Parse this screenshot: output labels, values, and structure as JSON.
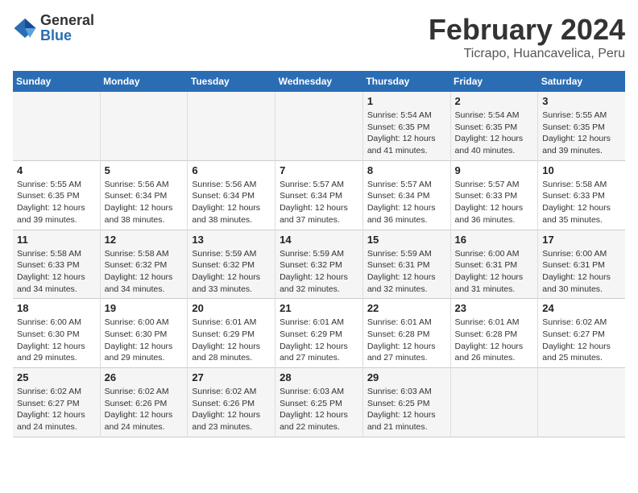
{
  "header": {
    "logo_general": "General",
    "logo_blue": "Blue",
    "title": "February 2024",
    "subtitle": "Ticrapo, Huancavelica, Peru"
  },
  "weekdays": [
    "Sunday",
    "Monday",
    "Tuesday",
    "Wednesday",
    "Thursday",
    "Friday",
    "Saturday"
  ],
  "weeks": [
    {
      "days": [
        {
          "num": "",
          "info": ""
        },
        {
          "num": "",
          "info": ""
        },
        {
          "num": "",
          "info": ""
        },
        {
          "num": "",
          "info": ""
        },
        {
          "num": "1",
          "info": "Sunrise: 5:54 AM\nSunset: 6:35 PM\nDaylight: 12 hours\nand 41 minutes."
        },
        {
          "num": "2",
          "info": "Sunrise: 5:54 AM\nSunset: 6:35 PM\nDaylight: 12 hours\nand 40 minutes."
        },
        {
          "num": "3",
          "info": "Sunrise: 5:55 AM\nSunset: 6:35 PM\nDaylight: 12 hours\nand 39 minutes."
        }
      ]
    },
    {
      "days": [
        {
          "num": "4",
          "info": "Sunrise: 5:55 AM\nSunset: 6:35 PM\nDaylight: 12 hours\nand 39 minutes."
        },
        {
          "num": "5",
          "info": "Sunrise: 5:56 AM\nSunset: 6:34 PM\nDaylight: 12 hours\nand 38 minutes."
        },
        {
          "num": "6",
          "info": "Sunrise: 5:56 AM\nSunset: 6:34 PM\nDaylight: 12 hours\nand 38 minutes."
        },
        {
          "num": "7",
          "info": "Sunrise: 5:57 AM\nSunset: 6:34 PM\nDaylight: 12 hours\nand 37 minutes."
        },
        {
          "num": "8",
          "info": "Sunrise: 5:57 AM\nSunset: 6:34 PM\nDaylight: 12 hours\nand 36 minutes."
        },
        {
          "num": "9",
          "info": "Sunrise: 5:57 AM\nSunset: 6:33 PM\nDaylight: 12 hours\nand 36 minutes."
        },
        {
          "num": "10",
          "info": "Sunrise: 5:58 AM\nSunset: 6:33 PM\nDaylight: 12 hours\nand 35 minutes."
        }
      ]
    },
    {
      "days": [
        {
          "num": "11",
          "info": "Sunrise: 5:58 AM\nSunset: 6:33 PM\nDaylight: 12 hours\nand 34 minutes."
        },
        {
          "num": "12",
          "info": "Sunrise: 5:58 AM\nSunset: 6:32 PM\nDaylight: 12 hours\nand 34 minutes."
        },
        {
          "num": "13",
          "info": "Sunrise: 5:59 AM\nSunset: 6:32 PM\nDaylight: 12 hours\nand 33 minutes."
        },
        {
          "num": "14",
          "info": "Sunrise: 5:59 AM\nSunset: 6:32 PM\nDaylight: 12 hours\nand 32 minutes."
        },
        {
          "num": "15",
          "info": "Sunrise: 5:59 AM\nSunset: 6:31 PM\nDaylight: 12 hours\nand 32 minutes."
        },
        {
          "num": "16",
          "info": "Sunrise: 6:00 AM\nSunset: 6:31 PM\nDaylight: 12 hours\nand 31 minutes."
        },
        {
          "num": "17",
          "info": "Sunrise: 6:00 AM\nSunset: 6:31 PM\nDaylight: 12 hours\nand 30 minutes."
        }
      ]
    },
    {
      "days": [
        {
          "num": "18",
          "info": "Sunrise: 6:00 AM\nSunset: 6:30 PM\nDaylight: 12 hours\nand 29 minutes."
        },
        {
          "num": "19",
          "info": "Sunrise: 6:00 AM\nSunset: 6:30 PM\nDaylight: 12 hours\nand 29 minutes."
        },
        {
          "num": "20",
          "info": "Sunrise: 6:01 AM\nSunset: 6:29 PM\nDaylight: 12 hours\nand 28 minutes."
        },
        {
          "num": "21",
          "info": "Sunrise: 6:01 AM\nSunset: 6:29 PM\nDaylight: 12 hours\nand 27 minutes."
        },
        {
          "num": "22",
          "info": "Sunrise: 6:01 AM\nSunset: 6:28 PM\nDaylight: 12 hours\nand 27 minutes."
        },
        {
          "num": "23",
          "info": "Sunrise: 6:01 AM\nSunset: 6:28 PM\nDaylight: 12 hours\nand 26 minutes."
        },
        {
          "num": "24",
          "info": "Sunrise: 6:02 AM\nSunset: 6:27 PM\nDaylight: 12 hours\nand 25 minutes."
        }
      ]
    },
    {
      "days": [
        {
          "num": "25",
          "info": "Sunrise: 6:02 AM\nSunset: 6:27 PM\nDaylight: 12 hours\nand 24 minutes."
        },
        {
          "num": "26",
          "info": "Sunrise: 6:02 AM\nSunset: 6:26 PM\nDaylight: 12 hours\nand 24 minutes."
        },
        {
          "num": "27",
          "info": "Sunrise: 6:02 AM\nSunset: 6:26 PM\nDaylight: 12 hours\nand 23 minutes."
        },
        {
          "num": "28",
          "info": "Sunrise: 6:03 AM\nSunset: 6:25 PM\nDaylight: 12 hours\nand 22 minutes."
        },
        {
          "num": "29",
          "info": "Sunrise: 6:03 AM\nSunset: 6:25 PM\nDaylight: 12 hours\nand 21 minutes."
        },
        {
          "num": "",
          "info": ""
        },
        {
          "num": "",
          "info": ""
        }
      ]
    }
  ]
}
